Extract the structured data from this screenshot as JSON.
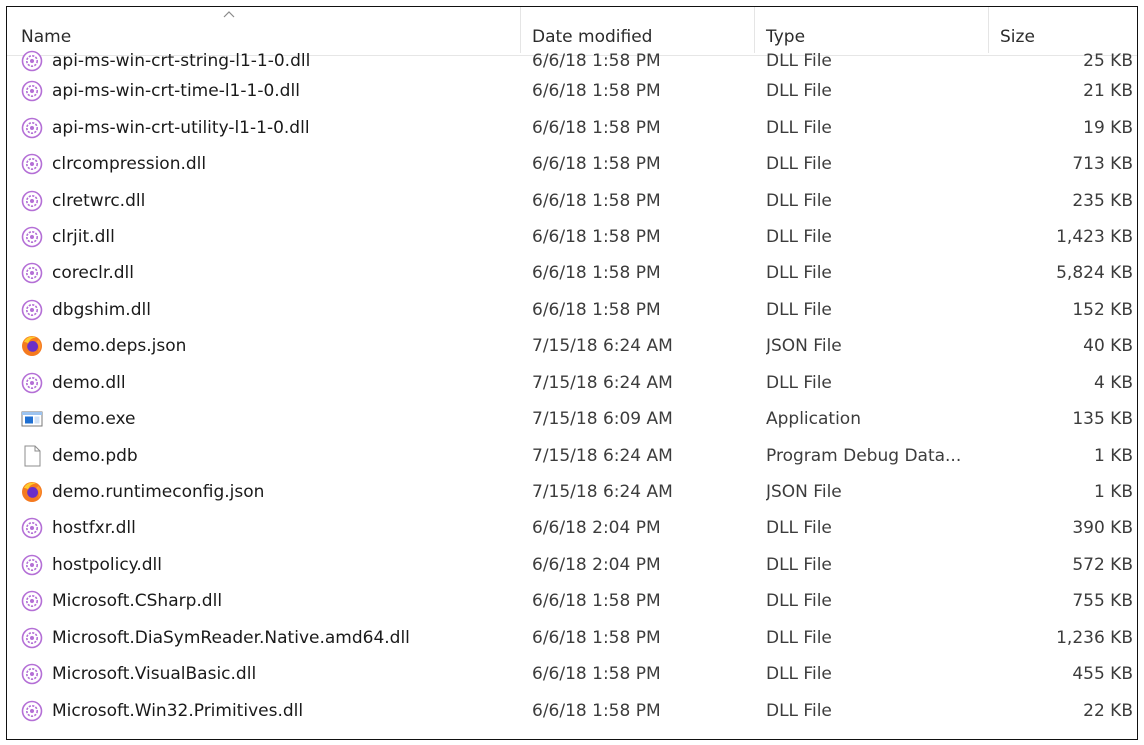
{
  "columns": {
    "name": "Name",
    "date": "Date modified",
    "type": "Type",
    "size": "Size"
  },
  "colors": {
    "dll_icon": "#b46fd6",
    "firefox_orange": "#f57a1f",
    "firefox_purple": "#6a2ec9",
    "exe_blue": "#1f6fd1"
  },
  "files": [
    {
      "name": "api-ms-win-crt-string-l1-1-0.dll",
      "date": "6/6/18 1:58 PM",
      "type": "DLL File",
      "size": "25 KB",
      "icon": "dll-gear-icon"
    },
    {
      "name": "api-ms-win-crt-time-l1-1-0.dll",
      "date": "6/6/18 1:58 PM",
      "type": "DLL File",
      "size": "21 KB",
      "icon": "dll-gear-icon"
    },
    {
      "name": "api-ms-win-crt-utility-l1-1-0.dll",
      "date": "6/6/18 1:58 PM",
      "type": "DLL File",
      "size": "19 KB",
      "icon": "dll-gear-icon"
    },
    {
      "name": "clrcompression.dll",
      "date": "6/6/18 1:58 PM",
      "type": "DLL File",
      "size": "713 KB",
      "icon": "dll-gear-icon"
    },
    {
      "name": "clretwrc.dll",
      "date": "6/6/18 1:58 PM",
      "type": "DLL File",
      "size": "235 KB",
      "icon": "dll-gear-icon"
    },
    {
      "name": "clrjit.dll",
      "date": "6/6/18 1:58 PM",
      "type": "DLL File",
      "size": "1,423 KB",
      "icon": "dll-gear-icon"
    },
    {
      "name": "coreclr.dll",
      "date": "6/6/18 1:58 PM",
      "type": "DLL File",
      "size": "5,824 KB",
      "icon": "dll-gear-icon"
    },
    {
      "name": "dbgshim.dll",
      "date": "6/6/18 1:58 PM",
      "type": "DLL File",
      "size": "152 KB",
      "icon": "dll-gear-icon"
    },
    {
      "name": "demo.deps.json",
      "date": "7/15/18 6:24 AM",
      "type": "JSON File",
      "size": "40 KB",
      "icon": "firefox-icon"
    },
    {
      "name": "demo.dll",
      "date": "7/15/18 6:24 AM",
      "type": "DLL File",
      "size": "4 KB",
      "icon": "dll-gear-icon"
    },
    {
      "name": "demo.exe",
      "date": "7/15/18 6:09 AM",
      "type": "Application",
      "size": "135 KB",
      "icon": "application-icon"
    },
    {
      "name": "demo.pdb",
      "date": "7/15/18 6:24 AM",
      "type": "Program Debug Data...",
      "size": "1 KB",
      "icon": "blank-file-icon"
    },
    {
      "name": "demo.runtimeconfig.json",
      "date": "7/15/18 6:24 AM",
      "type": "JSON File",
      "size": "1 KB",
      "icon": "firefox-icon"
    },
    {
      "name": "hostfxr.dll",
      "date": "6/6/18 2:04 PM",
      "type": "DLL File",
      "size": "390 KB",
      "icon": "dll-gear-icon"
    },
    {
      "name": "hostpolicy.dll",
      "date": "6/6/18 2:04 PM",
      "type": "DLL File",
      "size": "572 KB",
      "icon": "dll-gear-icon"
    },
    {
      "name": "Microsoft.CSharp.dll",
      "date": "6/6/18 1:58 PM",
      "type": "DLL File",
      "size": "755 KB",
      "icon": "dll-gear-icon"
    },
    {
      "name": "Microsoft.DiaSymReader.Native.amd64.dll",
      "date": "6/6/18 1:58 PM",
      "type": "DLL File",
      "size": "1,236 KB",
      "icon": "dll-gear-icon"
    },
    {
      "name": "Microsoft.VisualBasic.dll",
      "date": "6/6/18 1:58 PM",
      "type": "DLL File",
      "size": "455 KB",
      "icon": "dll-gear-icon"
    },
    {
      "name": "Microsoft.Win32.Primitives.dll",
      "date": "6/6/18 1:58 PM",
      "type": "DLL File",
      "size": "22 KB",
      "icon": "dll-gear-icon"
    }
  ]
}
